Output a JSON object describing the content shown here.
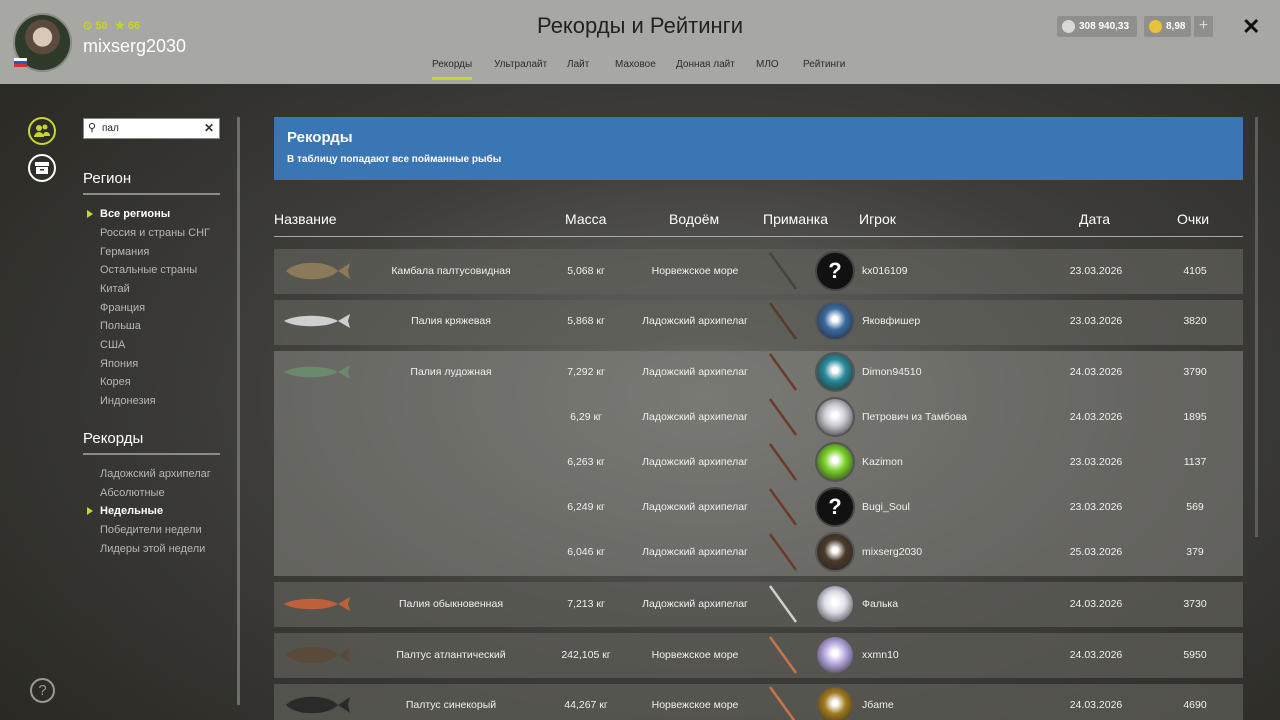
{
  "header": {
    "title": "Рекорды и Рейтинги",
    "username": "mixserg2030",
    "stat_a": "50",
    "stat_b": "66",
    "silver": "308 940,33",
    "gold": "8,98",
    "tabs": [
      {
        "label": "Рекорды",
        "active": true
      },
      {
        "label": "Ультралайт"
      },
      {
        "label": "Лайт"
      },
      {
        "label": "Маховое"
      },
      {
        "label": "Донная лайт"
      },
      {
        "label": "МЛО"
      },
      {
        "label": "Рейтинги"
      }
    ],
    "plus": "+",
    "close": "✕"
  },
  "sidebar": {
    "search_value": "пал",
    "region_title": "Регион",
    "regions": [
      "Все регионы",
      "Россия и страны СНГ",
      "Германия",
      "Остальные страны",
      "Китай",
      "Франция",
      "Польша",
      "США",
      "Япония",
      "Корея",
      "Индонезия"
    ],
    "records_title": "Рекорды",
    "records": [
      "Ладожский архипелаг",
      "Абсолютные",
      "Недельные",
      "Победители недели",
      "Лидеры этой недели"
    ],
    "help": "?"
  },
  "banner": {
    "title": "Рекорды",
    "subtitle": "В таблицу попадают все пойманные рыбы"
  },
  "table": {
    "columns": [
      "Название",
      "Масса",
      "Водоём",
      "Приманка",
      "Игрок",
      "Дата",
      "Очки"
    ],
    "rows": [
      {
        "fish": "Камбала палтусовидная",
        "mass": "5,068 кг",
        "water": "Норвежское море",
        "player": "kx016109",
        "date": "23.03.2026",
        "points": "4105"
      },
      {
        "fish": "Палия кряжевая",
        "mass": "5,868 кг",
        "water": "Ладожский архипелаг",
        "player": "Яковфишер",
        "date": "23.03.2026",
        "points": "3820"
      },
      {
        "fish": "Палия лудожная",
        "mass": "7,292 кг",
        "water": "Ладожский архипелаг",
        "player": "Dimon94510",
        "date": "24.03.2026",
        "points": "3790"
      },
      {
        "fish": "",
        "mass": "6,29 кг",
        "water": "Ладожский архипелаг",
        "player": "Петрович из Тамбова",
        "date": "24.03.2026",
        "points": "1895"
      },
      {
        "fish": "",
        "mass": "6,263 кг",
        "water": "Ладожский архипелаг",
        "player": "Kazimon",
        "date": "23.03.2026",
        "points": "1137"
      },
      {
        "fish": "",
        "mass": "6,249 кг",
        "water": "Ладожский архипелаг",
        "player": "Bugi_Soul",
        "date": "23.03.2026",
        "points": "569"
      },
      {
        "fish": "",
        "mass": "6,046 кг",
        "water": "Ладожский архипелаг",
        "player": "mixserg2030",
        "date": "25.03.2026",
        "points": "379"
      },
      {
        "fish": "Палия обыкновенная",
        "mass": "7,213 кг",
        "water": "Ладожский архипелаг",
        "player": "Фалька",
        "date": "24.03.2026",
        "points": "3730"
      },
      {
        "fish": "Палтус атлантический",
        "mass": "242,105 кг",
        "water": "Норвежское море",
        "player": "xxmn10",
        "date": "24.03.2026",
        "points": "5950"
      },
      {
        "fish": "Палтус синекорый",
        "mass": "44,267 кг",
        "water": "Норвежское море",
        "player": "Jбame",
        "date": "24.03.2026",
        "points": "4690"
      }
    ]
  },
  "colors": {
    "accent": "#c7d82a",
    "banner": "#3b76b4",
    "header": "#a7a8a3"
  }
}
